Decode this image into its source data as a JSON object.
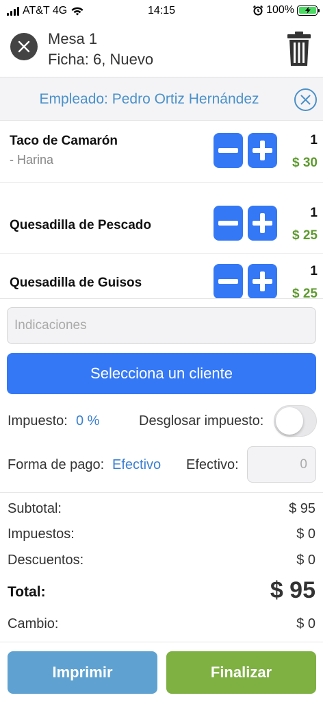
{
  "status_bar": {
    "carrier": "AT&T 4G",
    "time": "14:15",
    "battery": "100%",
    "battery_level": 1.0,
    "icons": [
      "signal-icon",
      "wifi-icon",
      "alarm-icon",
      "battery-charging-icon"
    ]
  },
  "header": {
    "title": "Mesa 1",
    "subtitle": "Ficha: 6, Nuevo",
    "icons": [
      "close-icon",
      "trash-icon"
    ]
  },
  "employee": {
    "label": "Empleado: Pedro Ortiz Hernández",
    "color": "#4a90c9"
  },
  "items": [
    {
      "name": "Taco de Camarón",
      "modifier": "- Harina",
      "qty": "1",
      "price": "$ 30"
    },
    {
      "name": "Quesadilla de Pescado",
      "modifier": "",
      "qty": "1",
      "price": "$ 25"
    },
    {
      "name": "Quesadilla de Guisos",
      "modifier": "",
      "qty": "1",
      "price": "$ 25"
    }
  ],
  "notes": {
    "placeholder": "Indicaciones",
    "value": ""
  },
  "client_button": "Selecciona un cliente",
  "tax": {
    "label": "Impuesto:",
    "value": "0 %",
    "breakdown_label": "Desglosar impuesto:",
    "breakdown_on": false
  },
  "payment": {
    "label": "Forma de pago:",
    "method": "Efectivo",
    "cash_label": "Efectivo:",
    "cash_placeholder": "0"
  },
  "summary": {
    "subtotal_label": "Subtotal:",
    "subtotal": "$ 95",
    "taxes_label": "Impuestos:",
    "taxes": "$ 0",
    "discounts_label": "Descuentos:",
    "discounts": "$ 0",
    "total_label": "Total:",
    "total": "$ 95",
    "change_label": "Cambio:",
    "change": "$ 0"
  },
  "actions": {
    "print": "Imprimir",
    "finish": "Finalizar"
  },
  "colors": {
    "primary_blue": "#3478f6",
    "print_blue": "#5fa2d1",
    "finish_green": "#7eb042",
    "price_green": "#5e9a2f"
  }
}
